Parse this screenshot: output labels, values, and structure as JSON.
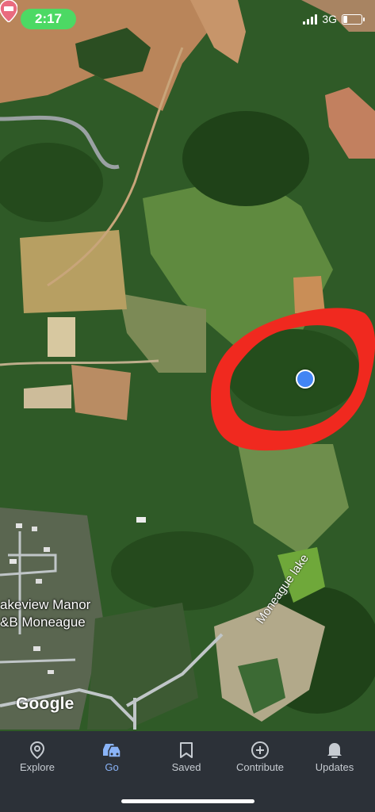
{
  "status_bar": {
    "time": "2:17",
    "network": "3G"
  },
  "map": {
    "poi_label_line1": "akeview Manor",
    "poi_label_line2": "&B Moneague",
    "lake_label": "Moneague lake",
    "attribution": "Google",
    "colors": {
      "annotation_circle": "#f0291f",
      "location_dot": "#4285f4"
    }
  },
  "bottom_nav": {
    "items": [
      {
        "label": "Explore",
        "icon": "location-pin-icon"
      },
      {
        "label": "Go",
        "icon": "car-icon",
        "active": true
      },
      {
        "label": "Saved",
        "icon": "bookmark-icon"
      },
      {
        "label": "Contribute",
        "icon": "plus-circle-icon"
      },
      {
        "label": "Updates",
        "icon": "bell-icon"
      }
    ]
  }
}
